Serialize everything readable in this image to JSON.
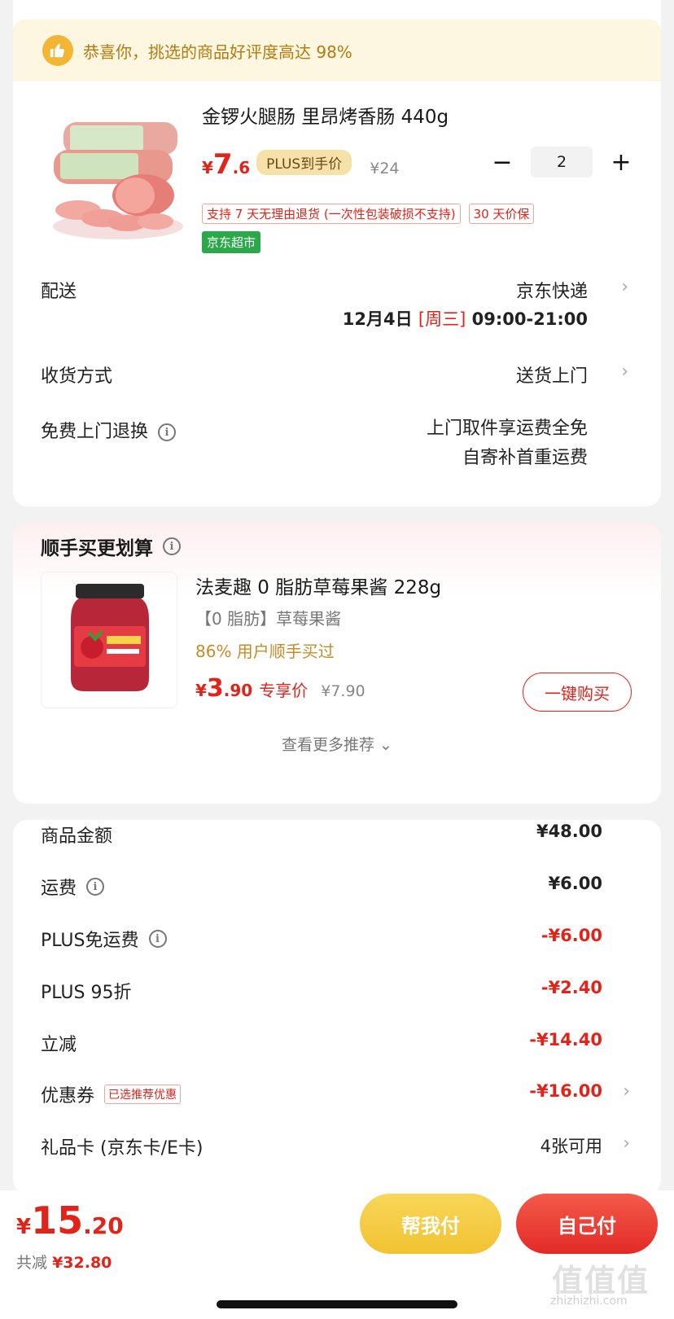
{
  "banner": {
    "text": "恭喜你，挑选的商品好评度高达 98%"
  },
  "product": {
    "title": "金锣火腿肠 里昂烤香肠 440g",
    "currency": "¥",
    "price_int": "7",
    "price_dec": ".6",
    "plus_label": "PLUS到手价",
    "original_price": "¥24",
    "quantity": "2",
    "minus": "−",
    "plus": "+",
    "tags": [
      "支持 7 天无理由退货 (一次性包装破损不支持)",
      "30 天价保"
    ],
    "store_tag": "京东超市"
  },
  "delivery": {
    "label": "配送",
    "method": "京东快递",
    "date": "12月4日",
    "weekday": "[周三]",
    "time": "09:00-21:00"
  },
  "receive": {
    "label": "收货方式",
    "value": "送货上门"
  },
  "return_service": {
    "label": "免费上门退换",
    "line1": "上门取件享运费全免",
    "line2": "自寄补首重运费"
  },
  "recommend": {
    "title": "顺手买更划算",
    "item_title": "法麦趣 0 脂肪草莓果酱 228g",
    "item_sub": "【0 脂肪】草莓果酱",
    "item_hint": "86% 用户顺手买过",
    "currency": "¥",
    "price_int": "3",
    "price_dec": ".90",
    "exclusive": "专享价",
    "old_price": "¥7.90",
    "buy_label": "一键购买",
    "more_label": "查看更多推荐 ⌄"
  },
  "summary": {
    "rows": [
      {
        "label": "商品金额",
        "value": "¥48.00"
      },
      {
        "label": "运费",
        "value": "¥6.00"
      },
      {
        "label": "PLUS免运费",
        "value": "-¥6.00"
      },
      {
        "label": "PLUS 95折",
        "value": "-¥2.40"
      },
      {
        "label": "立减",
        "value": "-¥14.40"
      },
      {
        "label": "优惠券",
        "value": "-¥16.00",
        "tag": "已选推荐优惠"
      },
      {
        "label": "礼品卡 (京东卡/E卡)",
        "value": "4张可用"
      }
    ]
  },
  "footer": {
    "currency": "¥",
    "total_int": "15",
    "total_dec": ".20",
    "saved_label": "共减",
    "saved_value": "¥32.80",
    "help_pay": "帮我付",
    "self_pay": "自己付"
  },
  "watermark": {
    "text": "值值值",
    "url": "zhizhizhi.com"
  },
  "colors": {
    "accent": "#e2231a",
    "gold": "#f1c232",
    "banner_bg": "#fdf6e0",
    "jd_green": "#2aa84a"
  }
}
